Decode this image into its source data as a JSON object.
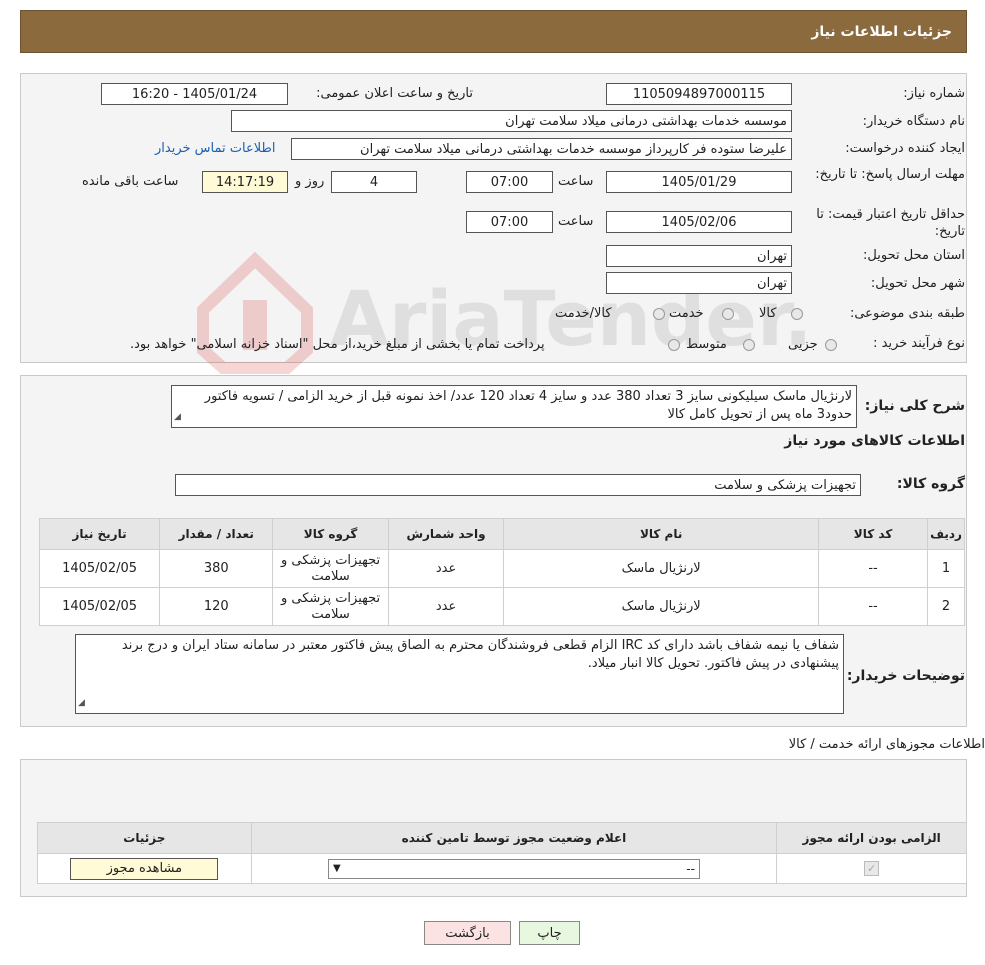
{
  "header": {
    "title": "جزئیات اطلاعات نیاز"
  },
  "fields": {
    "need_number_label": "شماره نیاز:",
    "need_number": "1105094897000115",
    "announce_label": "تاریخ و ساعت اعلان عمومی:",
    "announce_value": "1405/01/24 - 16:20",
    "buyer_org_label": "نام دستگاه خریدار:",
    "buyer_org": "موسسه خدمات بهداشتی درمانی میلاد سلامت تهران",
    "requester_label": "ایجاد کننده درخواست:",
    "requester": "علیرضا ستوده فر کارپرداز موسسه خدمات بهداشتی درمانی میلاد سلامت تهران",
    "contact_link": "اطلاعات تماس خریدار",
    "deadline_label": "مهلت ارسال پاسخ: تا تاریخ:",
    "deadline_date": "1405/01/29",
    "time_label": "ساعت",
    "deadline_time": "07:00",
    "days_value": "4",
    "days_label": "روز و",
    "remaining_time": "14:17:19",
    "remaining_label": "ساعت باقی مانده",
    "validity_label": "حداقل تاریخ اعتبار قیمت: تا تاریخ:",
    "validity_date": "1405/02/06",
    "validity_time": "07:00",
    "province_label": "استان محل تحویل:",
    "province": "تهران",
    "city_label": "شهر محل تحویل:",
    "city": "تهران",
    "category_label": "طبقه بندی موضوعی:",
    "category_options": [
      "کالا",
      "خدمت",
      "کالا/خدمت"
    ],
    "process_label": "نوع فرآیند خرید :",
    "process_options": [
      "جزیی",
      "متوسط"
    ],
    "process_note": "پرداخت تمام یا بخشی از مبلغ خرید،از محل \"اسناد خزانه اسلامی\" خواهد بود."
  },
  "description": {
    "label": "شرح کلی نیاز:",
    "text": "لارنژیال ماسک سیلیکونی سایز 3 تعداد 380 عدد و سایز 4 تعداد 120 عدد/ اخذ نمونه قبل از خرید الزامی / تسویه فاکتور حدود3 ماه پس از تحویل کامل کالا"
  },
  "goods": {
    "section_title": "اطلاعات کالاهای مورد نیاز",
    "group_label": "گروه کالا:",
    "group_value": "تجهیزات پزشکی و سلامت",
    "columns": [
      "ردیف",
      "کد کالا",
      "نام کالا",
      "واحد شمارش",
      "گروه کالا",
      "تعداد / مقدار",
      "تاریخ نیاز"
    ],
    "rows": [
      {
        "row": "1",
        "code": "--",
        "name": "لارنژیال ماسک",
        "unit": "عدد",
        "group": "تجهیزات پزشکی و سلامت",
        "qty": "380",
        "date": "1405/02/05"
      },
      {
        "row": "2",
        "code": "--",
        "name": "لارنژیال ماسک",
        "unit": "عدد",
        "group": "تجهیزات پزشکی و سلامت",
        "qty": "120",
        "date": "1405/02/05"
      }
    ]
  },
  "buyer_notes": {
    "label": "توضیحات خریدار:",
    "text": "شفاف یا نیمه شفاف باشد دارای کد IRC الزام قطعی فروشندگان محترم به الصاق پیش فاکتور معتبر در سامانه ستاد ایران و درج برند پیشنهادی در پیش فاکتور. تحویل کالا انبار میلاد."
  },
  "permits": {
    "section_title": "اطلاعات مجوزهای ارائه خدمت / کالا",
    "columns": [
      "الزامی بودن ارائه مجوز",
      "اعلام وضعیت مجوز توسط تامین کننده",
      "جزئیات"
    ],
    "select_value": "--",
    "view_button": "مشاهده مجوز"
  },
  "buttons": {
    "print": "چاپ",
    "back": "بازگشت"
  },
  "watermark": "AriaTender.neT"
}
